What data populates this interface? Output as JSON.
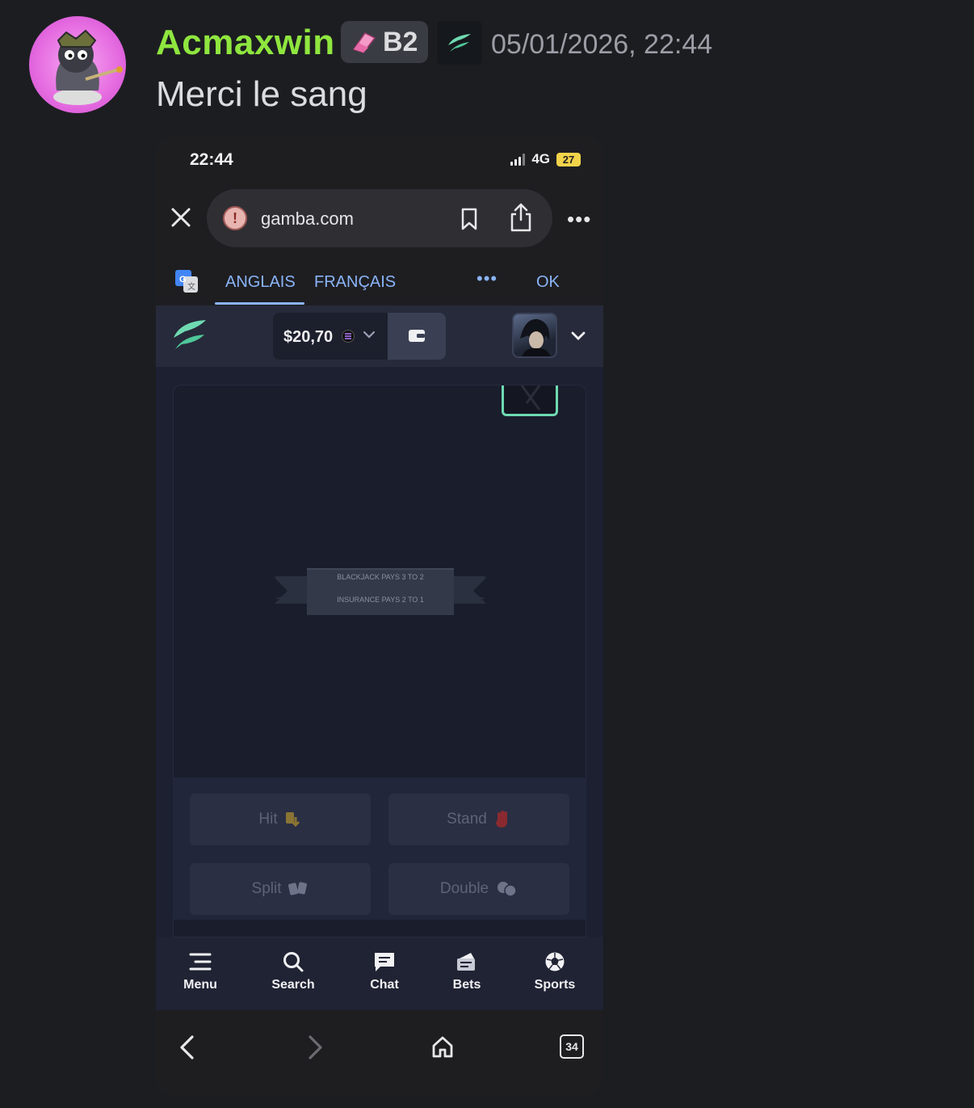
{
  "message": {
    "username": "Acmaxwin",
    "user_color": "#8fe63f",
    "tag": "B2",
    "timestamp": "05/01/2026, 22:44",
    "text": "Merci le sang"
  },
  "phone": {
    "status": {
      "time": "22:44",
      "network": "4G",
      "battery": "27"
    },
    "browser": {
      "url": "gamba.com",
      "tabs_count": "34"
    },
    "translate": {
      "lang_from": "ANGLAIS",
      "lang_to": "FRANÇAIS",
      "more": "•••",
      "ok": "OK"
    },
    "site": {
      "balance": "$20,70",
      "accent": "#6fdab2",
      "banner_line1": "BLACKJACK PAYS 3 TO 2",
      "banner_line2": "INSURANCE PAYS 2 TO 1",
      "actions": {
        "hit": "Hit",
        "stand": "Stand",
        "split": "Split",
        "double": "Double"
      },
      "nav": [
        {
          "label": "Menu",
          "icon": "menu-icon"
        },
        {
          "label": "Search",
          "icon": "search-icon"
        },
        {
          "label": "Chat",
          "icon": "chat-icon"
        },
        {
          "label": "Bets",
          "icon": "bets-icon"
        },
        {
          "label": "Sports",
          "icon": "soccer-ball-icon"
        }
      ]
    }
  }
}
